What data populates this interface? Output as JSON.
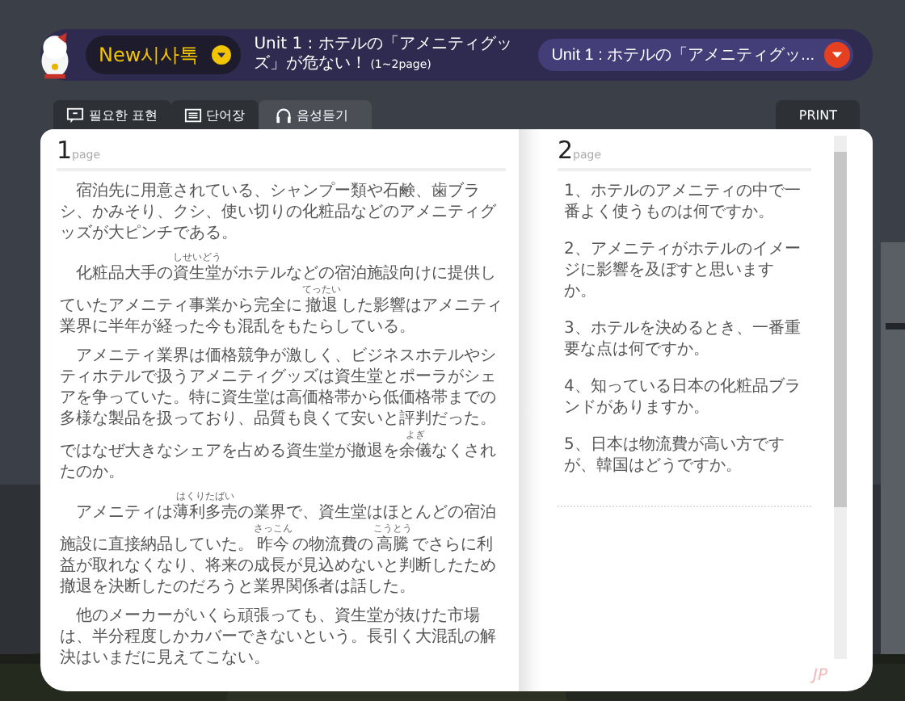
{
  "header": {
    "brand": "New시사톡",
    "title": "Unit 1 : ホテルの「アメニティグッズ」が危ない！",
    "title_pages": "(1~2page)",
    "unit_select": "Unit 1 : ホテルの「アメニティグッ..."
  },
  "tabs": [
    {
      "label": "필요한 표현",
      "selected": false
    },
    {
      "label": "단어장",
      "selected": false
    },
    {
      "label": "음성듣기",
      "selected": true
    }
  ],
  "print_button": "PRINT",
  "left_page": {
    "number": "1",
    "suffix": "page",
    "paragraphs": [
      [
        {
          "text": "宿泊先に用意されている、シャンプー類や石鹸、歯ブラシ、かみそり、クシ、使い切りの化粧品などのアメニティグッズが大ピンチである。"
        }
      ],
      [
        {
          "text": "化粧品大手の"
        },
        {
          "text": "資生堂",
          "ruby": "しせいどう"
        },
        {
          "text": "がホテルなどの宿泊施設向けに提供していたアメニティ事業から完全に"
        },
        {
          "text": "撤退",
          "ruby": "てったい"
        },
        {
          "text": "した影響はアメニティ業界に半年が経った今も混乱をもたらしている。"
        }
      ],
      [
        {
          "text": "アメニティ業界は価格競争が激しく、ビジネスホテルやシティホテルで扱うアメニティグッズは資生堂とポーラがシェアを争っていた。特に資生堂は高価格帯から低価格帯までの多様な製品を扱っており、品質も良くて安いと評判だった。ではなぜ大きなシェアを占める資生堂が撤退を"
        },
        {
          "text": "余儀",
          "ruby": "よぎ"
        },
        {
          "text": "なくされたのか。"
        }
      ],
      [
        {
          "text": "アメニティは"
        },
        {
          "text": "薄利多売",
          "ruby": "はくりたばい"
        },
        {
          "text": "の業界で、資生堂はほとんどの宿泊施設に直接納品していた。"
        },
        {
          "text": "昨今",
          "ruby": "さっこん"
        },
        {
          "text": "の物流費の"
        },
        {
          "text": "高騰",
          "ruby": "こうとう"
        },
        {
          "text": "でさらに利益が取れなくなり、将来の成長が見込めないと判断したため撤退を決断したのだろうと業界関係者は話した。"
        }
      ],
      [
        {
          "text": "他のメーカーがいくら頑張っても、資生堂が抜けた市場は、半分程度しかカバーできないという。長引く大混乱の解決はいまだに見えてこない。"
        }
      ]
    ]
  },
  "right_page": {
    "number": "2",
    "suffix": "page",
    "questions": [
      "1、ホテルのアメニティの中で一番よく使うものは何ですか。",
      "2、アメニティがホテルのイメージに影響を及ぼすと思いますか。",
      "3、ホテルを決めるとき、一番重要な点は何ですか。",
      "4、知っている日本の化粧品ブランドがありますか。",
      "5、日本は物流費が高い方ですが、韓国はどうですか。"
    ]
  },
  "corner_mark": "JP"
}
